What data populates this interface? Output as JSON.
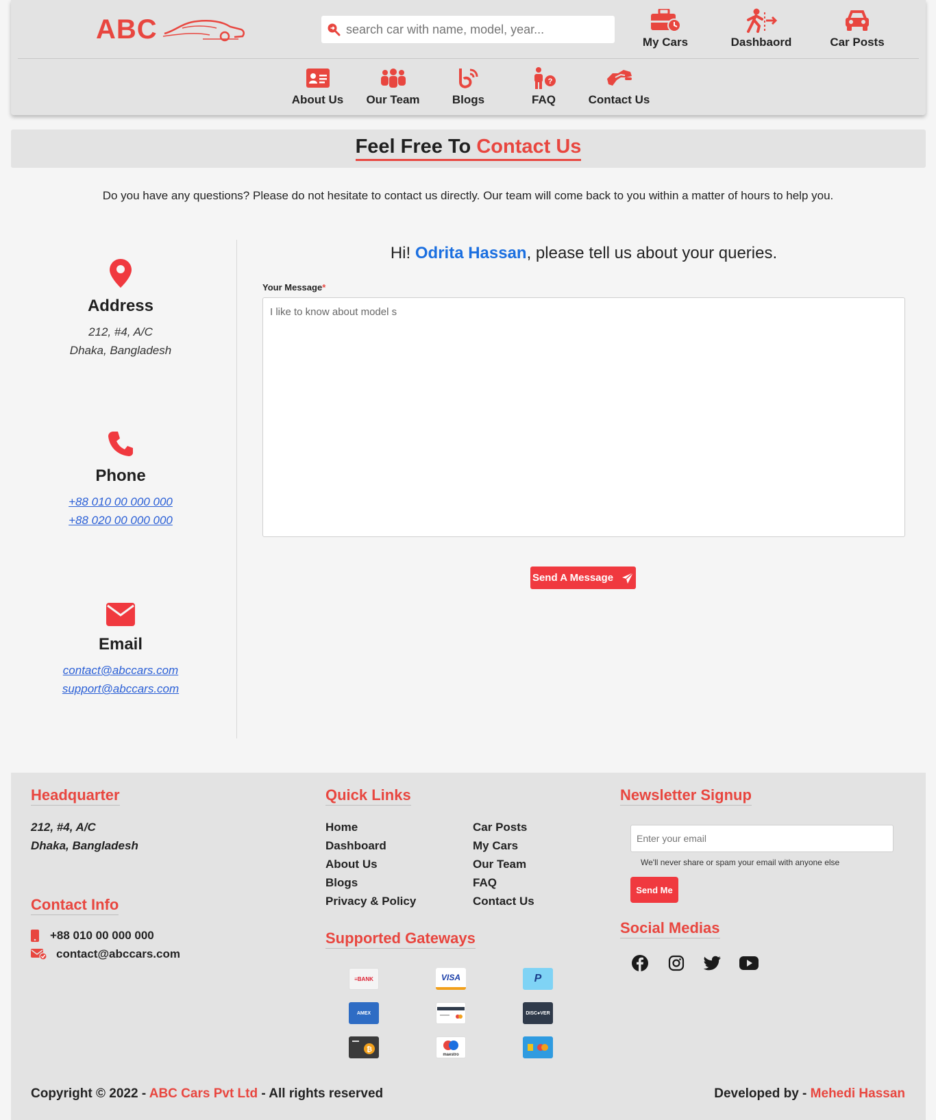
{
  "brand": {
    "logo_text": "ABC",
    "accent_color": "#e8463f"
  },
  "search": {
    "placeholder": "search car with name, model, year..."
  },
  "top_nav": [
    {
      "label": "My Cars",
      "icon": "briefcase-clock-icon"
    },
    {
      "label": "Dashbaord",
      "icon": "person-exit-icon"
    },
    {
      "label": "Car Posts",
      "icon": "car-icon"
    }
  ],
  "sub_nav": [
    {
      "label": "About Us",
      "icon": "id-card-icon"
    },
    {
      "label": "Our Team",
      "icon": "people-group-icon"
    },
    {
      "label": "Blogs",
      "icon": "blog-icon"
    },
    {
      "label": "FAQ",
      "icon": "person-question-icon"
    },
    {
      "label": "Contact Us",
      "icon": "handshake-icon"
    }
  ],
  "page": {
    "title_part1": "Feel Free To",
    "title_part2": "Contact Us",
    "intro": "Do you have any questions? Please do not hesitate to contact us directly. Our team will come back to you within a matter of hours to help you."
  },
  "contact_info": {
    "address": {
      "heading": "Address",
      "line1": "212, #4, A/C",
      "line2": "Dhaka, Bangladesh",
      "icon": "location-pin-icon"
    },
    "phone": {
      "heading": "Phone",
      "line1": "+88 010 00 000 000",
      "line2": "+88 020 00 000 000",
      "icon": "phone-icon"
    },
    "email": {
      "heading": "Email",
      "line1": "contact@abccars.com",
      "line2": "support@abccars.com",
      "icon": "envelope-icon"
    }
  },
  "form": {
    "greeting_prefix": "Hi!",
    "user_name": "Odrita Hassan",
    "greeting_suffix": ", please tell us about your queries.",
    "message_label": "Your Message",
    "required_mark": "*",
    "message_value": "I like to know about model s",
    "send_label": "Send A Message"
  },
  "footer": {
    "headquarter": {
      "heading": "Headquarter",
      "line1": "212, #4, A/C",
      "line2": "Dhaka, Bangladesh"
    },
    "contact": {
      "heading": "Contact Info",
      "phone": "+88 010 00 000 000",
      "email": "contact@abccars.com"
    },
    "quick_links": {
      "heading": "Quick Links",
      "items": [
        "Home",
        "Car Posts",
        "Dashboard",
        "My Cars",
        "About Us",
        "Our Team",
        "Blogs",
        "FAQ",
        "Privacy & Policy",
        "Contact Us"
      ]
    },
    "gateways": {
      "heading": "Supported Gateways",
      "items": [
        "bank-transfer-icon",
        "visa-icon",
        "paypal-icon",
        "american-express-icon",
        "generic-card-icon",
        "discover-icon",
        "bitcoin-icon",
        "maestro-icon",
        "mastercard-icon"
      ]
    },
    "newsletter": {
      "heading": "Newsletter Signup",
      "placeholder": "Enter your email",
      "note": "We'll never share or spam your email with anyone else",
      "button": "Send Me"
    },
    "social": {
      "heading": "Social Medias",
      "items": [
        "facebook-icon",
        "instagram-icon",
        "twitter-icon",
        "youtube-icon"
      ]
    },
    "copyright_prefix": "Copyright © 2022 -",
    "company": "ABC Cars Pvt Ltd",
    "copyright_suffix": "- All rights reserved",
    "developed_prefix": "Developed by -",
    "developer": "Mehedi Hassan"
  }
}
